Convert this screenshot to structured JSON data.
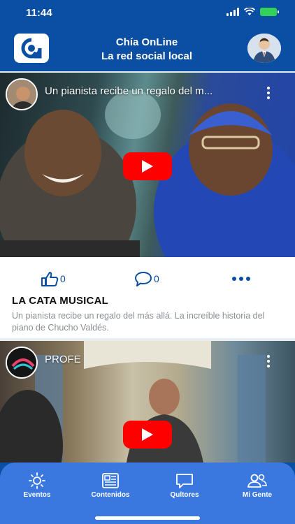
{
  "status": {
    "time": "11:44"
  },
  "header": {
    "title_line1": "Chía OnLine",
    "title_line2": "La red social local"
  },
  "posts": [
    {
      "video_title": "Un pianista recibe un regalo del m...",
      "likes": "0",
      "comments": "0",
      "title": "LA CATA MUSICAL",
      "description": "Un pianista recibe un regalo del más allá. La increíble historia del piano de Chucho Valdés."
    },
    {
      "video_title": "PROFE"
    }
  ],
  "nav": {
    "items": [
      {
        "label": "Eventos",
        "icon": "sun-icon"
      },
      {
        "label": "Contenidos",
        "icon": "newspaper-icon"
      },
      {
        "label": "Qultores",
        "icon": "chat-bubble-icon"
      },
      {
        "label": "Mi Gente",
        "icon": "people-icon"
      }
    ]
  },
  "colors": {
    "brand": "#0a4fa3",
    "nav": "#3a78e0",
    "play": "#ff0000",
    "battery": "#33d15a"
  }
}
